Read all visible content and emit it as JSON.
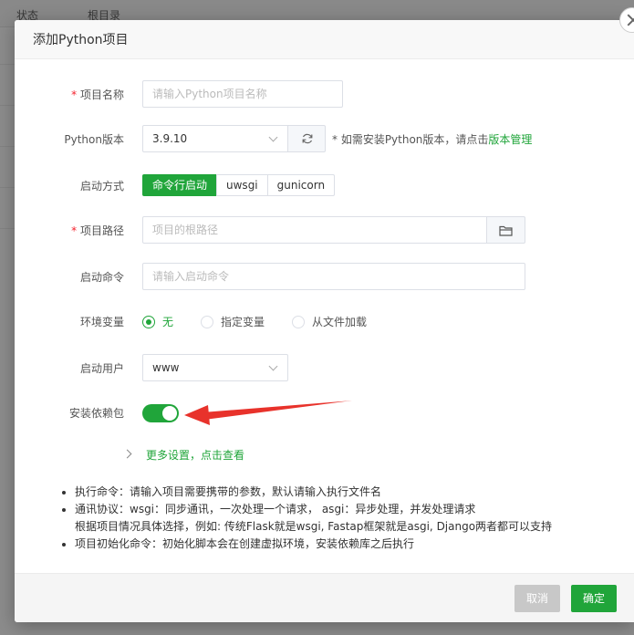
{
  "background": {
    "col_status": "状态",
    "col_root": "根目录"
  },
  "dialog": {
    "title": "添加Python项目",
    "close_icon": "close-icon"
  },
  "form": {
    "project_name": {
      "label": "项目名称",
      "placeholder": "请输入Python项目名称"
    },
    "python_version": {
      "label": "Python版本",
      "value": "3.9.10",
      "refresh_icon": "refresh-icon",
      "hint_text": "* 如需安装Python版本，请点击",
      "hint_link": "版本管理"
    },
    "start_mode": {
      "label": "启动方式",
      "options": [
        "命令行启动",
        "uwsgi",
        "gunicorn"
      ],
      "selected": "命令行启动"
    },
    "project_path": {
      "label": "项目路径",
      "placeholder": "项目的根路径",
      "folder_icon": "folder-icon"
    },
    "start_command": {
      "label": "启动命令",
      "placeholder": "请输入启动命令"
    },
    "env_vars": {
      "label": "环境变量",
      "options": [
        "无",
        "指定变量",
        "从文件加载"
      ],
      "selected": "无"
    },
    "run_user": {
      "label": "启动用户",
      "value": "www"
    },
    "install_deps": {
      "label": "安装依赖包",
      "enabled": true
    },
    "more_settings": "更多设置，点击查看"
  },
  "notes": [
    "执行命令：请输入项目需要携带的参数，默认请输入执行文件名",
    "通讯协议：wsgi：同步通讯，一次处理一个请求， asgi：异步处理，并发处理请求",
    "根据项目情况具体选择，例如: 传统Flask就是wsgi, Fastap框架就是asgi, Django两者都可以支持",
    "项目初始化命令：初始化脚本会在创建虚拟环境，安装依赖库之后执行"
  ],
  "footer": {
    "cancel_label": "取消",
    "confirm_label": "确定"
  },
  "colors": {
    "accent": "#20a53a",
    "annotation_arrow": "#e8322b"
  }
}
